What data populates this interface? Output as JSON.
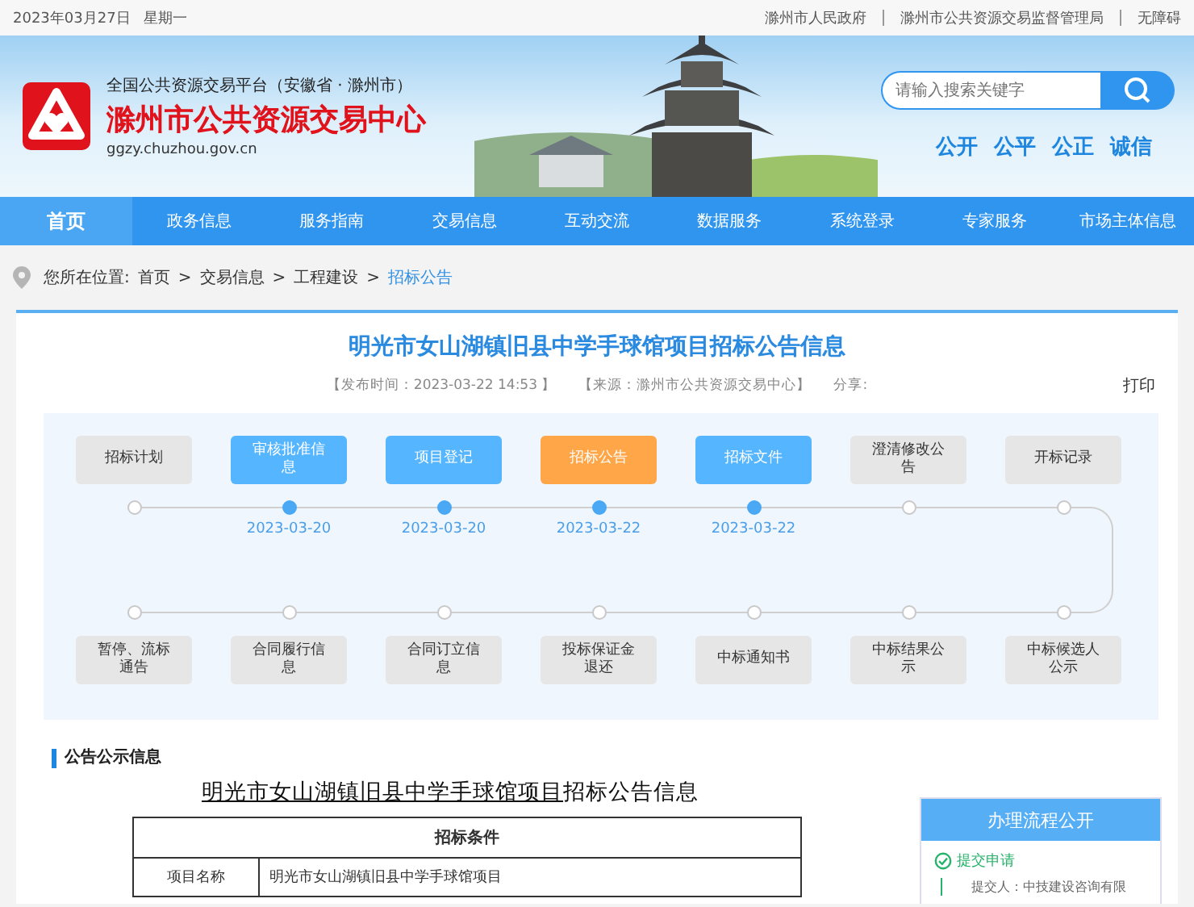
{
  "top_bar": {
    "date": "2023年03月27日",
    "weekday": "星期一",
    "links": [
      "滁州市人民政府",
      "滁州市公共资源交易监督管理局",
      "无障碍"
    ]
  },
  "header": {
    "platform": "全国公共资源交易平台（安徽省 · 滁州市）",
    "site_name": "滁州市公共资源交易中心",
    "domain": "ggzy.chuzhou.gov.cn",
    "search": {
      "placeholder": "请输入搜索关键字"
    },
    "slogans": [
      "公开",
      "公平",
      "公正",
      "诚信"
    ]
  },
  "nav": [
    {
      "label": "首页",
      "selected": true
    },
    {
      "label": "政务信息",
      "selected": false
    },
    {
      "label": "服务指南",
      "selected": false
    },
    {
      "label": "交易信息",
      "selected": false
    },
    {
      "label": "互动交流",
      "selected": false
    },
    {
      "label": "数据服务",
      "selected": false
    },
    {
      "label": "系统登录",
      "selected": false
    },
    {
      "label": "专家服务",
      "selected": false
    },
    {
      "label": "市场主体信息",
      "selected": false
    }
  ],
  "breadcrumb": {
    "prefix": "您所在位置:",
    "items": [
      {
        "label": "首页",
        "current": false
      },
      {
        "label": "交易信息",
        "current": false
      },
      {
        "label": "工程建设",
        "current": false
      },
      {
        "label": "招标公告",
        "current": true
      }
    ],
    "separator": ">"
  },
  "article": {
    "title": "明光市女山湖镇旧县中学手球馆项目招标公告信息",
    "published": "【发布时间：2023-03-22 14:53 】",
    "source": "【来源：滁州市公共资源交易中心】",
    "share": "分享:",
    "print": "打印"
  },
  "steps_top": [
    {
      "label": "招标计划",
      "done": false,
      "current": false
    },
    {
      "label": "审核批准信息",
      "done": true,
      "current": false,
      "date": "2023-03-20"
    },
    {
      "label": "项目登记",
      "done": true,
      "current": false,
      "date": "2023-03-20"
    },
    {
      "label": "招标公告",
      "done": true,
      "current": true,
      "date": "2023-03-22"
    },
    {
      "label": "招标文件",
      "done": true,
      "current": false,
      "date": "2023-03-22"
    },
    {
      "label": "澄清修改公告",
      "done": false,
      "current": false
    },
    {
      "label": "开标记录",
      "done": false,
      "current": false
    }
  ],
  "steps_bottom": [
    {
      "label": "暂停、流标通告",
      "done": false,
      "current": false
    },
    {
      "label": "合同履行信息",
      "done": false,
      "current": false
    },
    {
      "label": "合同订立信息",
      "done": false,
      "current": false
    },
    {
      "label": "投标保证金退还",
      "done": false,
      "current": false
    },
    {
      "label": "中标通知书",
      "done": false,
      "current": false
    },
    {
      "label": "中标结果公示",
      "done": false,
      "current": false
    },
    {
      "label": "中标候选人公示",
      "done": false,
      "current": false
    }
  ],
  "notice": {
    "section_title": "公告公示信息",
    "doc_title": {
      "underlined": "明光市女山湖镇旧县中学手球馆项目",
      "rest": "招标公告信息"
    },
    "table": {
      "heading": "招标条件",
      "rows": [
        {
          "label": "项目名称",
          "value": "明光市女山湖镇旧县中学手球馆项目"
        }
      ]
    }
  },
  "process_panel": {
    "title": "办理流程公开",
    "steps": [
      {
        "label": "提交申请",
        "detail": "提交人：中技建设咨询有限"
      }
    ]
  }
}
